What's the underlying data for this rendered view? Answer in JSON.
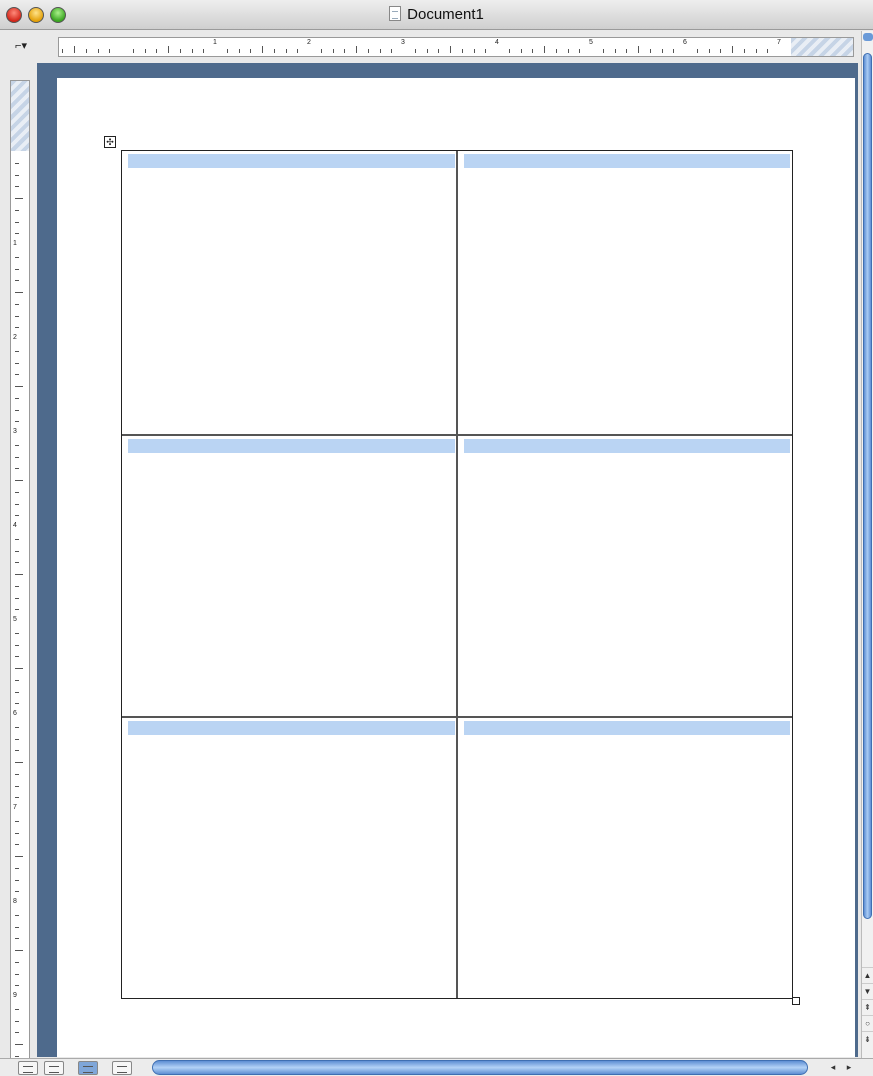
{
  "window": {
    "title": "Document1"
  },
  "ruler": {
    "horizontal_numbers": [
      "1",
      "2",
      "3",
      "4",
      "5",
      "6",
      "7"
    ],
    "vertical_numbers": [
      "1",
      "2",
      "3",
      "4",
      "5",
      "6",
      "7",
      "8",
      "9"
    ]
  },
  "table": {
    "rows": 3,
    "columns": 2,
    "cells": [
      "",
      "",
      "",
      "",
      "",
      ""
    ]
  },
  "colors": {
    "workspace_background": "#4e6a8c",
    "cell_highlight": "#bad4f3",
    "scrollbar_accent": "#5d8ed3"
  },
  "icons": {
    "tab_selector": "left-tab-icon",
    "table_move_handle": "table-move-handle-icon",
    "table_resize_handle": "table-resize-handle-icon"
  }
}
